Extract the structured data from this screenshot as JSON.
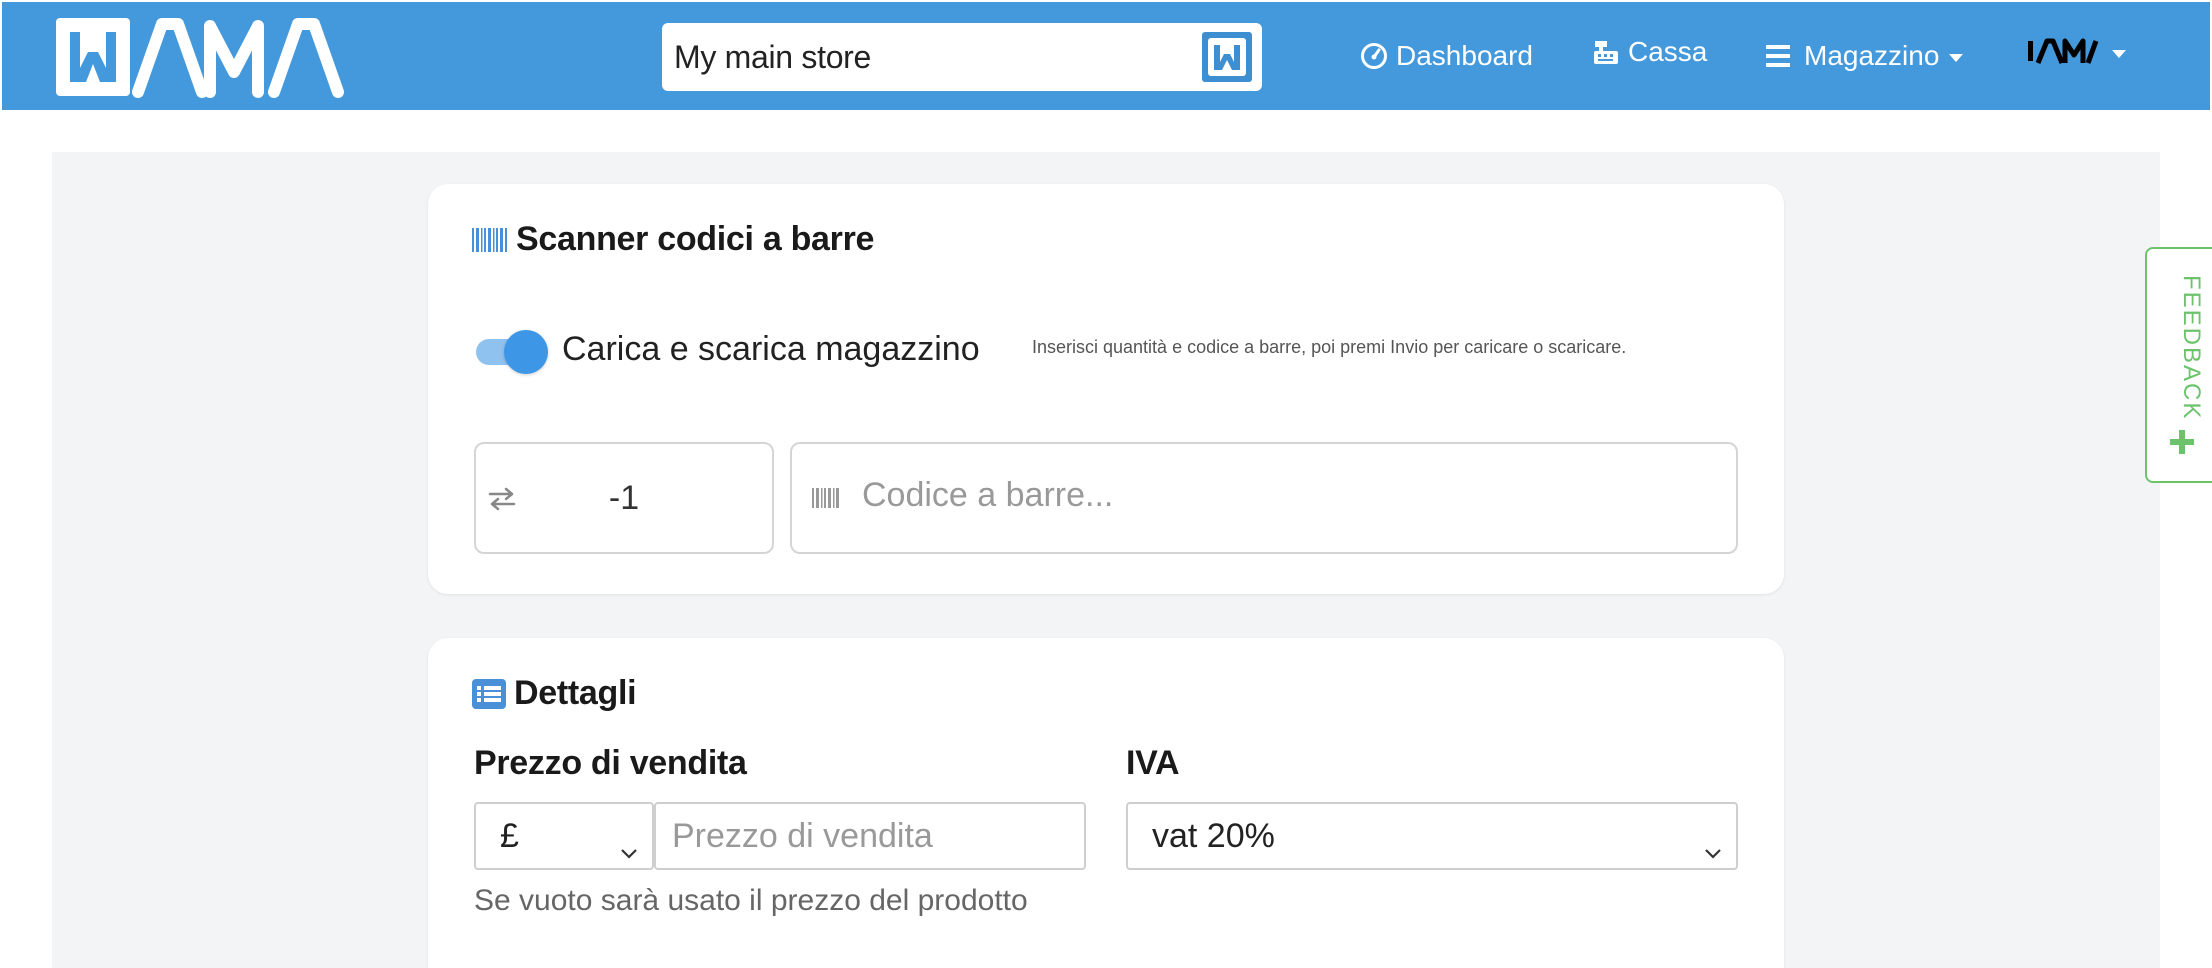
{
  "brand": {
    "logo_text": "WAMA",
    "logo_icon": "wama-logo"
  },
  "navbar": {
    "store": {
      "name": "My main store",
      "badge_icon": "wama-w-icon"
    },
    "items": [
      {
        "label": "Dashboard",
        "icon": "dashboard-gauge-icon"
      },
      {
        "label": "Cassa",
        "icon": "cash-register-icon"
      },
      {
        "label": "Magazzino",
        "icon": "hamburger-list-icon",
        "dropdown": true
      }
    ],
    "user": {
      "avatar_text": "WAMA",
      "dropdown": true
    }
  },
  "scanner": {
    "title": "Scanner codici a barre",
    "icon": "barcode-icon",
    "toggle": {
      "label": "Carica e scarica magazzino",
      "on": true
    },
    "hint": "Inserisci quantità e codice a barre, poi premi Invio per caricare o scaricare.",
    "quantity": {
      "value": "-1",
      "icon": "exchange-arrows-icon"
    },
    "barcode": {
      "placeholder": "Codice a barre...",
      "icon": "barcode-icon"
    }
  },
  "details": {
    "title": "Dettagli",
    "icon": "list-icon",
    "price": {
      "label": "Prezzo di vendita",
      "currency": "£",
      "placeholder": "Prezzo di vendita",
      "help": "Se vuoto sarà usato il prezzo del prodotto"
    },
    "vat": {
      "label": "IVA",
      "value": "vat 20%"
    }
  },
  "feedback": {
    "label": "FEEDBACK",
    "icon": "plus-icon"
  },
  "colors": {
    "navbar": "#4499dc",
    "accent": "#3e97e6",
    "feedback": "#6cc36c",
    "page_bg": "#f3f4f6"
  }
}
